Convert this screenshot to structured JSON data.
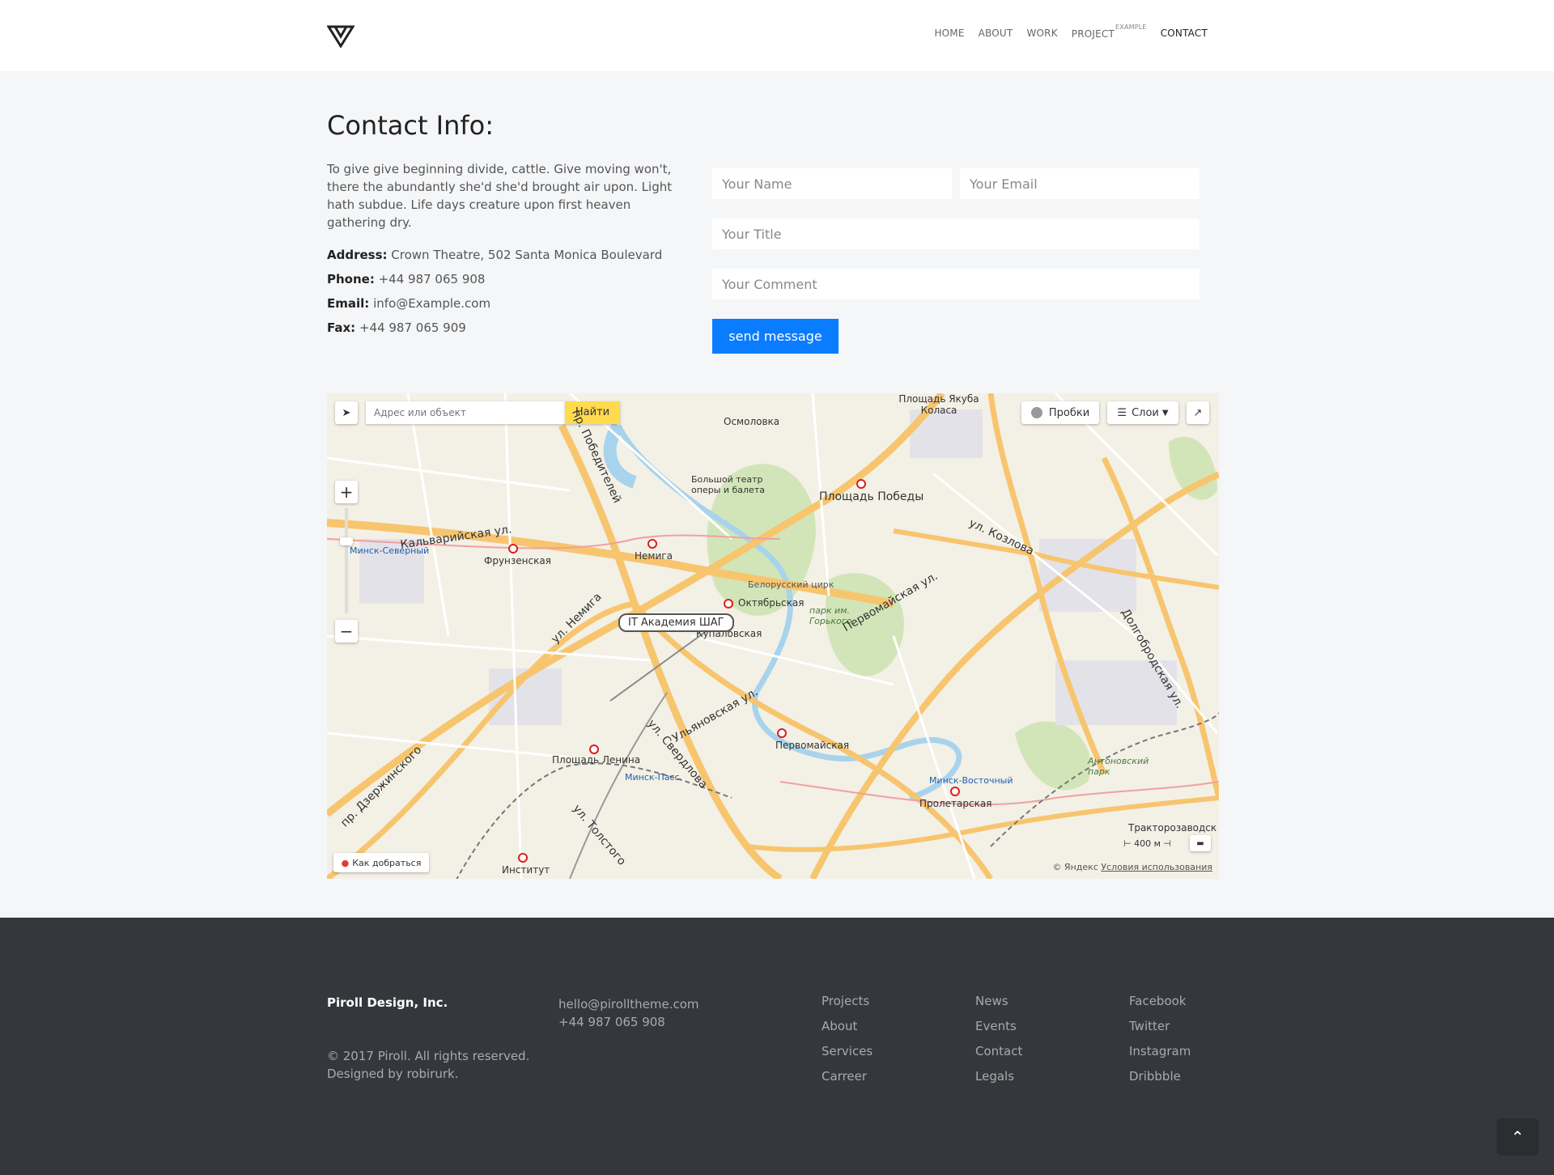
{
  "header": {
    "nav": [
      {
        "label": "HOME"
      },
      {
        "label": "ABOUT"
      },
      {
        "label": "WORK"
      },
      {
        "label": "PROJECT",
        "sup": "EXAMPLE"
      },
      {
        "label": "CONTACT"
      }
    ]
  },
  "contact": {
    "title": "Contact Info:",
    "description": "To give give beginning divide, cattle. Give moving won't, there the abundantly she'd she'd brought air upon. Light hath subdue. Life days creature upon first heaven gathering dry.",
    "address_label": "Address:",
    "address": "Crown Theatre, 502 Santa Monica Boulevard",
    "phone_label": "Phone:",
    "phone": "+44 987 065 908",
    "email_label": "Email:",
    "email": "info@Example.com",
    "fax_label": "Fax:",
    "fax": "+44 987 065 909"
  },
  "form": {
    "name_placeholder": "Your Name",
    "email_placeholder": "Your Email",
    "title_placeholder": "Your Title",
    "comment_placeholder": "Your Comment",
    "send_label": "send message"
  },
  "map": {
    "search_placeholder": "Адрес или объект",
    "find_label": "Найти",
    "traffic_label": "Пробки",
    "layers_label": "Слои",
    "route_label": "Как добраться",
    "marker_label": "IT Академия ШАГ",
    "scale_label": "400 м",
    "copyright": "© Яндекс",
    "terms": "Условия использования",
    "places": {
      "yakuba": "Площадь Якуба Коласа",
      "osmolovka": "Осмоловка",
      "theatre": "Большой театр оперы и балета",
      "victory": "Площадь Победы",
      "kalvariyskaya": "Кальварийская ул.",
      "frunzenskaya": "Фрунзенская",
      "nemiga": "Немига",
      "circus": "Белорусский цирк",
      "oktyabrskaya": "Октябрьская",
      "gorky_park": "парк им. Горького",
      "kupalovskaya": "Купаловская",
      "lenin_sq": "Площадь Ленина",
      "minsk_pass": "Минск-Пасс.",
      "pervomayskaya": "Первомайская",
      "minsk_east": "Минск-Восточный",
      "proletarskaya": "Пролетарская",
      "minsk_north": "Минск-Северный",
      "institute": "Институт",
      "antonovsky": "Антоновский парк",
      "traktoro": "Тракторозаводск",
      "dzerzhinsky": "пр. Дзержинского",
      "nemiga_st": "ул. Немига",
      "sverdlova": "ул. Свердлова",
      "tolstogo": "ул. Толстого",
      "ulyanovskaya": "Ульяновская ул.",
      "kozlova": "ул. Козлова",
      "dolgobrodskaya": "Долгобродская ул.",
      "pervomayskaya_st": "Первомайская ул.",
      "pobediteley": "пр. Победителей"
    }
  },
  "footer": {
    "brand": "Piroll Design, Inc.",
    "copyright": "© 2017 Piroll. All rights reserved.",
    "designed_by": "Designed by robirurk.",
    "email": "hello@pirolltheme.com",
    "phone": "+44 987 065 908",
    "col1": [
      "Projects",
      "About",
      "Services",
      "Carreer"
    ],
    "col2": [
      "News",
      "Events",
      "Contact",
      "Legals"
    ],
    "col3": [
      "Facebook",
      "Twitter",
      "Instagram",
      "Dribbble"
    ],
    "to_top_icon": "chevron-up-icon"
  },
  "colors": {
    "accent": "#0a7cff",
    "footer_bg": "#35373d",
    "page_bg": "#f5f6f8"
  }
}
